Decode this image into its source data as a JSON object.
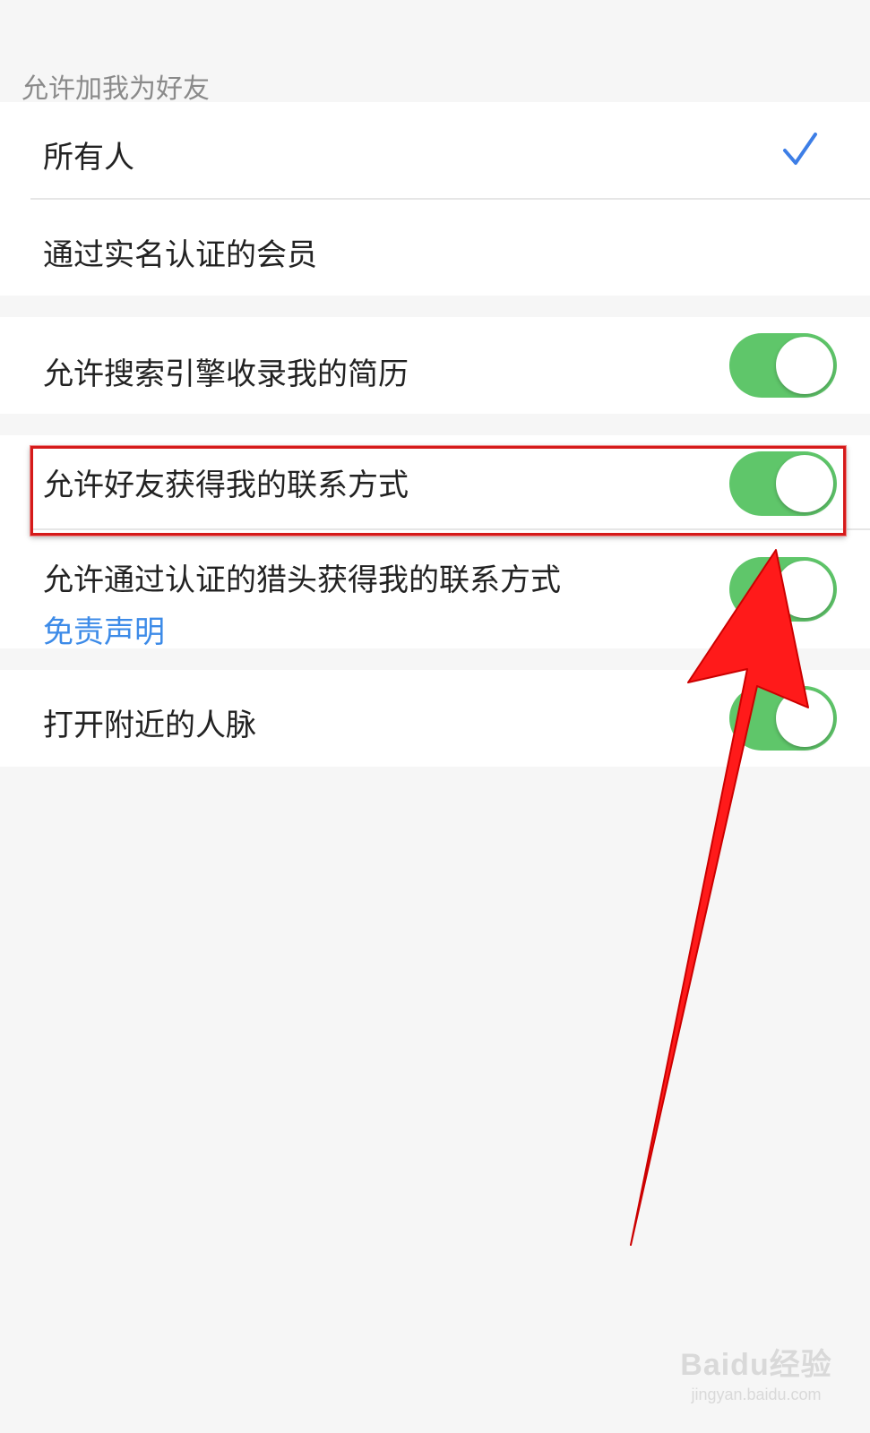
{
  "section": {
    "title": "允许加我为好友"
  },
  "friend_options": [
    {
      "label": "所有人",
      "selected": true
    },
    {
      "label": "通过实名认证的会员",
      "selected": false
    }
  ],
  "settings": {
    "search_engine": {
      "label": "允许搜索引擎收录我的简历",
      "on": true
    },
    "friends_contact": {
      "label": "允许好友获得我的联系方式",
      "on": true
    },
    "headhunter_contact": {
      "label": "允许通过认证的猎头获得我的联系方式",
      "on": true,
      "link": "免责声明"
    },
    "nearby": {
      "label": "打开附近的人脉",
      "on": true
    }
  },
  "colors": {
    "toggle_on": "#5fc66a",
    "check": "#3d7ee6",
    "link": "#3d8be8",
    "highlight": "#d51a1a",
    "arrow": "#ff1a1a"
  },
  "watermark": {
    "logo": "Baidu经验",
    "url": "jingyan.baidu.com"
  }
}
